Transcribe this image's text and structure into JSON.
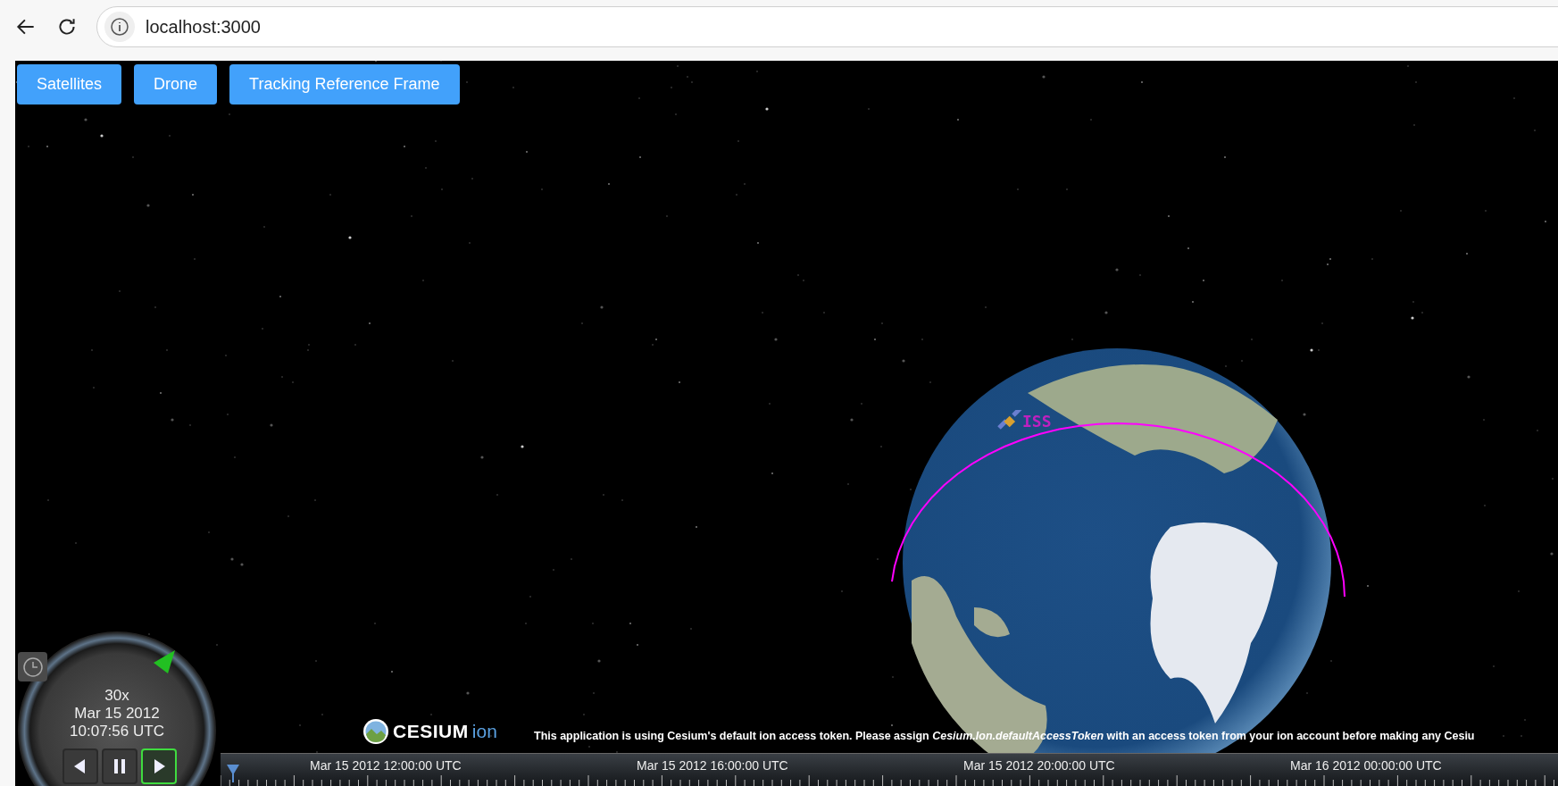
{
  "browser": {
    "url": "localhost:3000"
  },
  "toolbar": [
    {
      "label": "Satellites"
    },
    {
      "label": "Drone"
    },
    {
      "label": "Tracking Reference Frame"
    }
  ],
  "satellite": {
    "label": "ISS"
  },
  "animation": {
    "speed": "30x",
    "date": "Mar 15 2012",
    "time": "10:07:56 UTC",
    "buttons": [
      {
        "kind": "reverse",
        "selected": false
      },
      {
        "kind": "pause",
        "selected": false
      },
      {
        "kind": "play",
        "selected": true
      }
    ]
  },
  "credit": {
    "logo": "CESIUM",
    "logo_suffix": "ion",
    "message": "This application is using Cesium's default ion access token. Please assign *Cesium.Ion.defaultAccessToken* with an access token from your ion account before making any Cesiu"
  },
  "timeline": {
    "labels": [
      "Mar 15 2012 12:00:00 UTC",
      "Mar 15 2012 16:00:00 UTC",
      "Mar 15 2012 20:00:00 UTC",
      "Mar 16 2012 00:00:00 UTC"
    ]
  }
}
